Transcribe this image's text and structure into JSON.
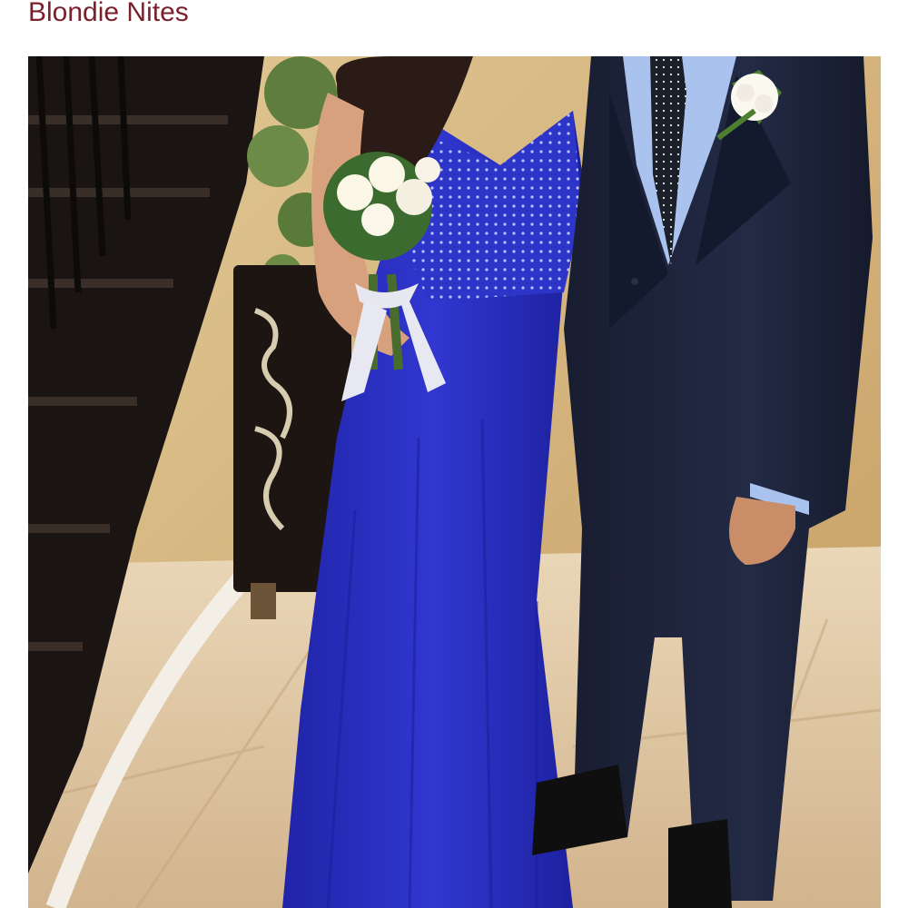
{
  "header": {
    "title": "Blondie Nites"
  },
  "photo": {
    "subject": "product-photo",
    "colors": {
      "title": "#7a1f2b",
      "dress": "#2a2fc2",
      "suit": "#1c2238",
      "shirt": "#a9c3ee",
      "floor": "#d7c2a3",
      "wall": "#d8b884",
      "stairs": "#1a1512"
    }
  }
}
